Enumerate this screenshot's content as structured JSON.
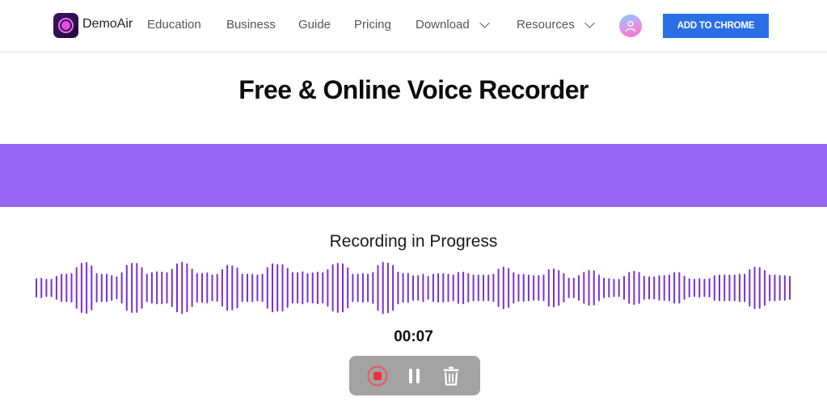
{
  "header": {
    "brand": "DemoAir",
    "nav": [
      {
        "label": "Education",
        "dropdown": false
      },
      {
        "label": "Business",
        "dropdown": false
      },
      {
        "label": "Guide",
        "dropdown": false
      },
      {
        "label": "Pricing",
        "dropdown": false
      },
      {
        "label": "Download",
        "dropdown": true
      },
      {
        "label": "Resources",
        "dropdown": true
      }
    ],
    "avatar_icon": "user-icon",
    "cta_label": "ADD TO CHROME"
  },
  "main": {
    "title": "Free & Online Voice Recorder",
    "status": "Recording in Progress",
    "timer": "00:07",
    "controls": [
      {
        "name": "stop",
        "icon": "stop-record-icon"
      },
      {
        "name": "pause",
        "icon": "pause-icon"
      },
      {
        "name": "delete",
        "icon": "trash-icon"
      }
    ]
  },
  "waveform": {
    "color": "#7b2fd0",
    "levels": [
      0.36,
      0.38,
      0.34,
      0.34,
      0.45,
      0.53,
      0.53,
      0.55,
      0.78,
      0.94,
      0.97,
      0.84,
      0.55,
      0.53,
      0.53,
      0.48,
      0.43,
      0.59,
      0.86,
      0.94,
      0.94,
      0.78,
      0.53,
      0.59,
      0.62,
      0.61,
      0.59,
      0.72,
      0.92,
      0.98,
      0.92,
      0.72,
      0.55,
      0.56,
      0.58,
      0.5,
      0.52,
      0.7,
      0.86,
      0.84,
      0.77,
      0.53,
      0.53,
      0.53,
      0.5,
      0.53,
      0.78,
      0.92,
      0.89,
      0.89,
      0.75,
      0.59,
      0.59,
      0.62,
      0.55,
      0.58,
      0.61,
      0.59,
      0.7,
      0.89,
      0.94,
      0.92,
      0.77,
      0.53,
      0.53,
      0.55,
      0.53,
      0.6,
      0.86,
      0.98,
      0.95,
      0.86,
      0.61,
      0.56,
      0.56,
      0.48,
      0.48,
      0.53,
      0.45,
      0.53,
      0.55,
      0.55,
      0.53,
      0.5,
      0.6,
      0.61,
      0.55,
      0.5,
      0.5,
      0.5,
      0.5,
      0.53,
      0.72,
      0.8,
      0.75,
      0.59,
      0.52,
      0.52,
      0.5,
      0.48,
      0.48,
      0.5,
      0.7,
      0.73,
      0.67,
      0.55,
      0.38,
      0.38,
      0.48,
      0.6,
      0.67,
      0.66,
      0.5,
      0.38,
      0.36,
      0.34,
      0.34,
      0.45,
      0.6,
      0.64,
      0.6,
      0.45,
      0.43,
      0.43,
      0.48,
      0.48,
      0.5,
      0.59,
      0.59,
      0.45,
      0.36,
      0.34,
      0.36,
      0.34,
      0.36,
      0.48,
      0.5,
      0.5,
      0.5,
      0.5,
      0.53,
      0.53,
      0.7,
      0.8,
      0.78,
      0.67,
      0.5,
      0.5,
      0.48,
      0.48,
      0.45
    ]
  }
}
